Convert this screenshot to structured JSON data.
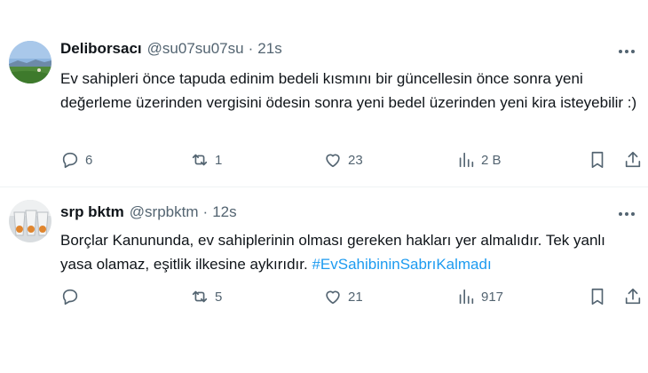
{
  "tweets": [
    {
      "display_name": "Deliborsacı",
      "handle": "@su07su07su",
      "separator": "·",
      "time": "21s",
      "text": "Ev sahipleri önce tapuda edinim bedeli kısmını bir güncellesin önce sonra yeni değerleme üzerinden vergisini ödesin sonra yeni bedel üzerinden yeni kira isteyebilir :)",
      "hashtag": "",
      "counts": {
        "replies": "6",
        "retweets": "1",
        "likes": "23",
        "views": "2 B"
      },
      "avatar": "landscape-avatar"
    },
    {
      "display_name": "srp bktm",
      "handle": "@srpbktm",
      "separator": "·",
      "time": "12s",
      "text": "Borçlar Kanununda, ev sahiplerinin olması gereken hakları yer almalıdır. Tek yanlı yasa olamaz, eşitlik ilkesine aykırıdır. ",
      "hashtag": "#EvSahibininSabrıKalmadı",
      "counts": {
        "replies": "",
        "retweets": "5",
        "likes": "21",
        "views": "917"
      },
      "avatar": "cups-avatar"
    }
  ],
  "icons": {
    "reply": "reply-icon",
    "retweet": "retweet-icon",
    "like": "heart-icon",
    "views": "views-icon",
    "bookmark": "bookmark-icon",
    "share": "share-icon",
    "more": "more-icon"
  },
  "colors": {
    "text": "#0f1419",
    "secondary": "#536471",
    "link": "#1d9bf0",
    "divider": "#eff3f4"
  }
}
